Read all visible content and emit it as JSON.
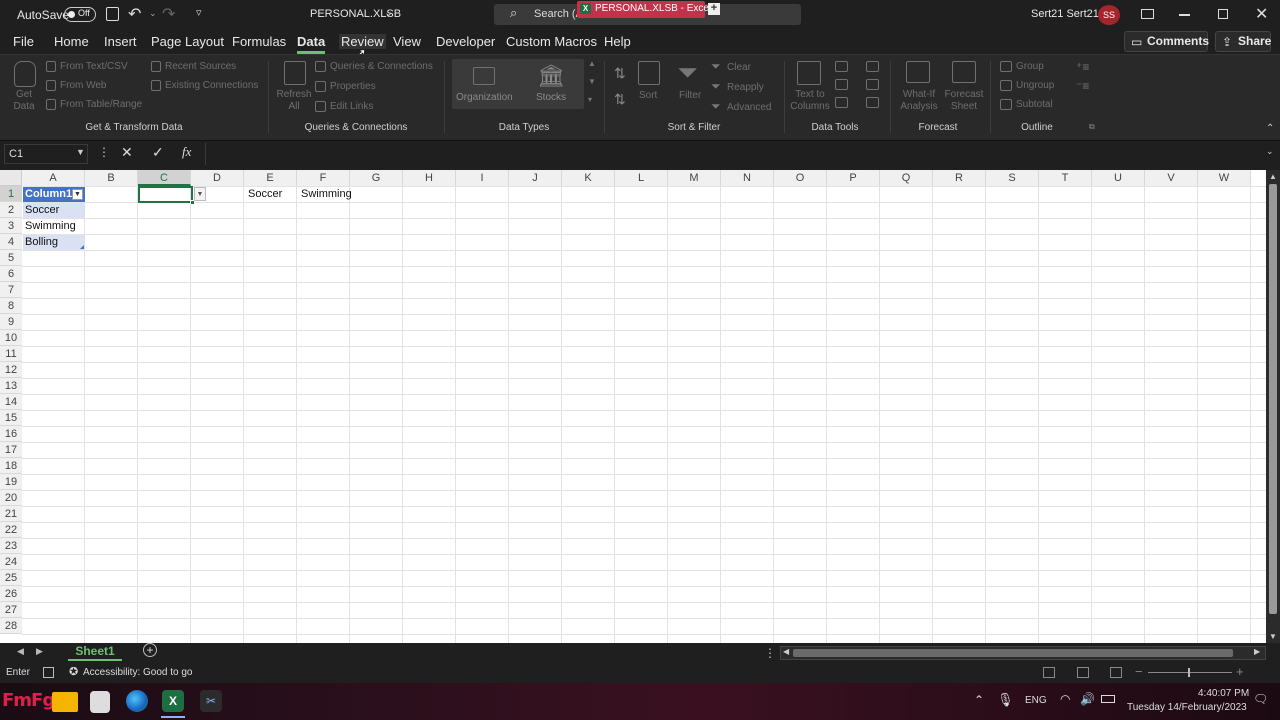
{
  "titlebar": {
    "autosave_label": "AutoSave",
    "autosave_state": "Off",
    "filename": "PERSONAL.XLSB",
    "search_placeholder": "Search (A",
    "window_tab_title": "PERSONAL.XLSB - Excel",
    "user_name": "Sert21 Sert21",
    "user_initials": "SS"
  },
  "menu": {
    "items": [
      "File",
      "Home",
      "Insert",
      "Page Layout",
      "Formulas",
      "Data",
      "Review",
      "View",
      "Developer",
      "Custom Macros",
      "Help"
    ],
    "active": "Data",
    "comments_label": "Comments",
    "share_label": "Share"
  },
  "ribbon": {
    "get_data": "Get Data",
    "from_text": "From Text/CSV",
    "from_web": "From Web",
    "from_table": "From Table/Range",
    "recent_sources": "Recent Sources",
    "existing_connections": "Existing Connections",
    "refresh_all": "Refresh All",
    "queries_connections": "Queries & Connections",
    "properties": "Properties",
    "edit_links": "Edit Links",
    "organization": "Organization",
    "stocks": "Stocks",
    "sort": "Sort",
    "filter": "Filter",
    "clear": "Clear",
    "reapply": "Reapply",
    "advanced": "Advanced",
    "text_to_columns": "Text to Columns",
    "what_if": "What-If Analysis",
    "forecast_sheet": "Forecast Sheet",
    "group": "Group",
    "ungroup": "Ungroup",
    "subtotal": "Subtotal",
    "groups": {
      "get_transform": "Get & Transform Data",
      "queries": "Queries & Connections",
      "data_types": "Data Types",
      "sort_filter": "Sort & Filter",
      "data_tools": "Data Tools",
      "forecast": "Forecast",
      "outline": "Outline"
    }
  },
  "formula_bar": {
    "name_box": "C1",
    "fx": "fx",
    "value": ""
  },
  "sheet": {
    "columns": [
      "A",
      "B",
      "C",
      "D",
      "E",
      "F",
      "G",
      "H",
      "I",
      "J",
      "K",
      "L",
      "M",
      "N",
      "O",
      "P",
      "Q",
      "R",
      "S",
      "T",
      "U",
      "V",
      "W"
    ],
    "rows": [
      "1",
      "2",
      "3",
      "4",
      "5",
      "6",
      "7",
      "8",
      "9",
      "10",
      "11",
      "12",
      "13",
      "14",
      "15",
      "16",
      "17",
      "18",
      "19",
      "20",
      "21",
      "22",
      "23",
      "24",
      "25",
      "26",
      "27",
      "28"
    ],
    "cells": {
      "A1": "Column1",
      "A2": "Soccer",
      "A3": "Swimming",
      "A4": "Bolling",
      "E1": "Soccer",
      "F1": "Swimming"
    },
    "selected_cell": "C1"
  },
  "tabs": {
    "sheet1": "Sheet1"
  },
  "status": {
    "mode": "Enter",
    "accessibility": "Accessibility: Good to go"
  },
  "taskbar": {
    "language": "ENG",
    "time": "4:40:07 PM",
    "date": "Tuesday 14/February/2023"
  },
  "colors": {
    "accent": "#6fbf73",
    "excel_green": "#1d6f42",
    "avatar": "#a4262c",
    "table_header": "#4472c4"
  }
}
